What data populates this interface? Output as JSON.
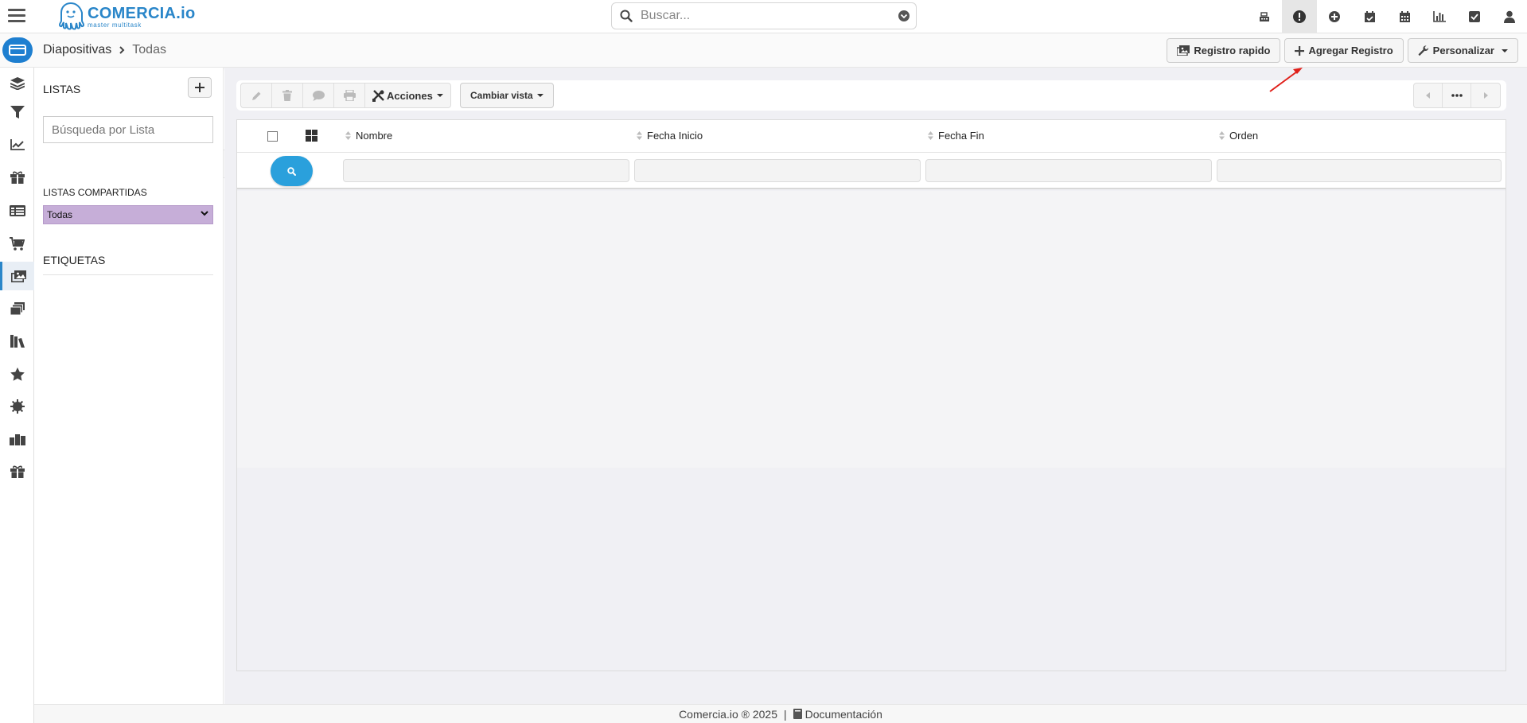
{
  "app": {
    "brand": "COMERCIA.io",
    "tagline": "master multitask"
  },
  "search": {
    "placeholder": "Buscar..."
  },
  "top_icons": [
    "cash-register-icon",
    "alert-icon",
    "add-circle-icon",
    "calendar-check-icon",
    "calendar-icon",
    "bar-chart-icon",
    "checkbox-icon",
    "user-icon"
  ],
  "breadcrumb": {
    "root": "Diapositivas",
    "current": "Todas"
  },
  "header_actions": {
    "quick": "Registro rapido",
    "add": "Agregar Registro",
    "customize": "Personalizar"
  },
  "rail_icons": [
    "layers-icon",
    "filter-icon",
    "line-chart-icon",
    "gift-icon",
    "table-list-icon",
    "cart-icon",
    "slides-icon",
    "stack-icon",
    "book-icon",
    "star-icon",
    "gear-icon",
    "boxes-icon",
    "gift-alt-icon"
  ],
  "lists_panel": {
    "title": "LISTAS",
    "search_placeholder": "Búsqueda por Lista",
    "shared_title": "LISTAS COMPARTIDAS",
    "shared_selected": "Todas",
    "tags_title": "ETIQUETAS"
  },
  "toolbar": {
    "actions_label": "Acciones",
    "view_label": "Cambiar vista"
  },
  "grid": {
    "columns": [
      "Nombre",
      "Fecha Inicio",
      "Fecha Fin",
      "Orden"
    ]
  },
  "footer": {
    "copyright": "Comercia.io ® 2025",
    "separator": "|",
    "docs": "Documentación"
  },
  "colors": {
    "brand": "#2a86c9",
    "search_button": "#2aa0dc",
    "shared_select": "#c6aed8",
    "annotation_arrow": "#e0201a"
  }
}
